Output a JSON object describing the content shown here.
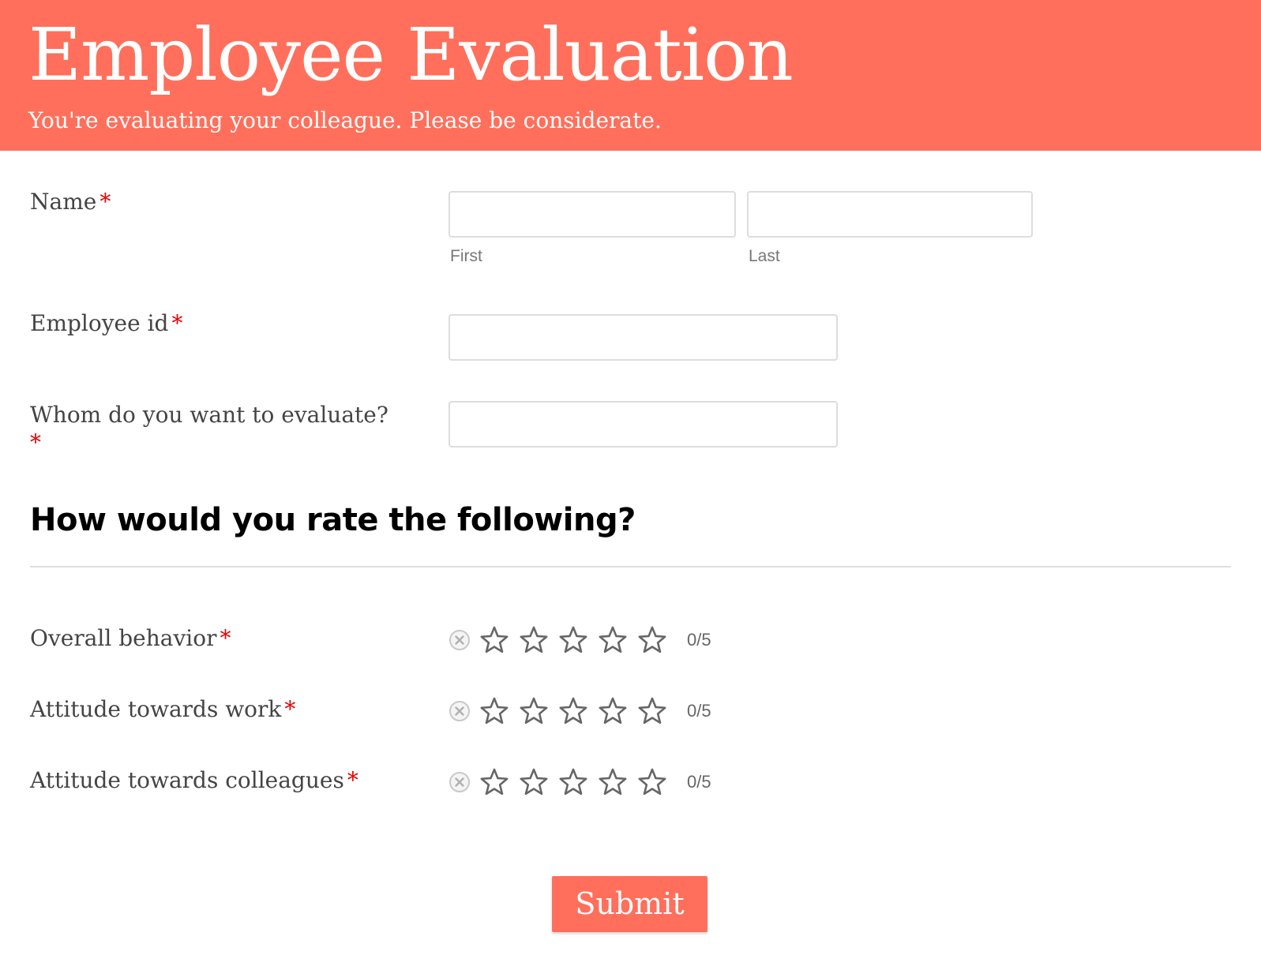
{
  "header": {
    "title": "Employee Evaluation",
    "subtitle": "You're evaluating your colleague. Please be considerate."
  },
  "required_marker": "*",
  "fields": {
    "name": {
      "label": "Name",
      "first": {
        "value": "",
        "sublabel": "First"
      },
      "last": {
        "value": "",
        "sublabel": "Last"
      }
    },
    "employee_id": {
      "label": "Employee id",
      "value": ""
    },
    "evaluate_whom": {
      "label": "Whom do you want to evaluate?",
      "value": ""
    }
  },
  "section": {
    "title": "How would you rate the following?"
  },
  "ratings": [
    {
      "label": "Overall behavior",
      "value": 0,
      "max": 5,
      "display": "0/5"
    },
    {
      "label": "Attitude towards work",
      "value": 0,
      "max": 5,
      "display": "0/5"
    },
    {
      "label": "Attitude towards colleagues",
      "value": 0,
      "max": 5,
      "display": "0/5"
    }
  ],
  "submit_label": "Submit",
  "colors": {
    "accent": "#ff6f5b",
    "required": "#e60000",
    "text": "#444444",
    "border": "#dddddd"
  },
  "icons": {
    "rating_cancel": "cancel-circle-icon",
    "rating_star": "star-outline-icon"
  }
}
